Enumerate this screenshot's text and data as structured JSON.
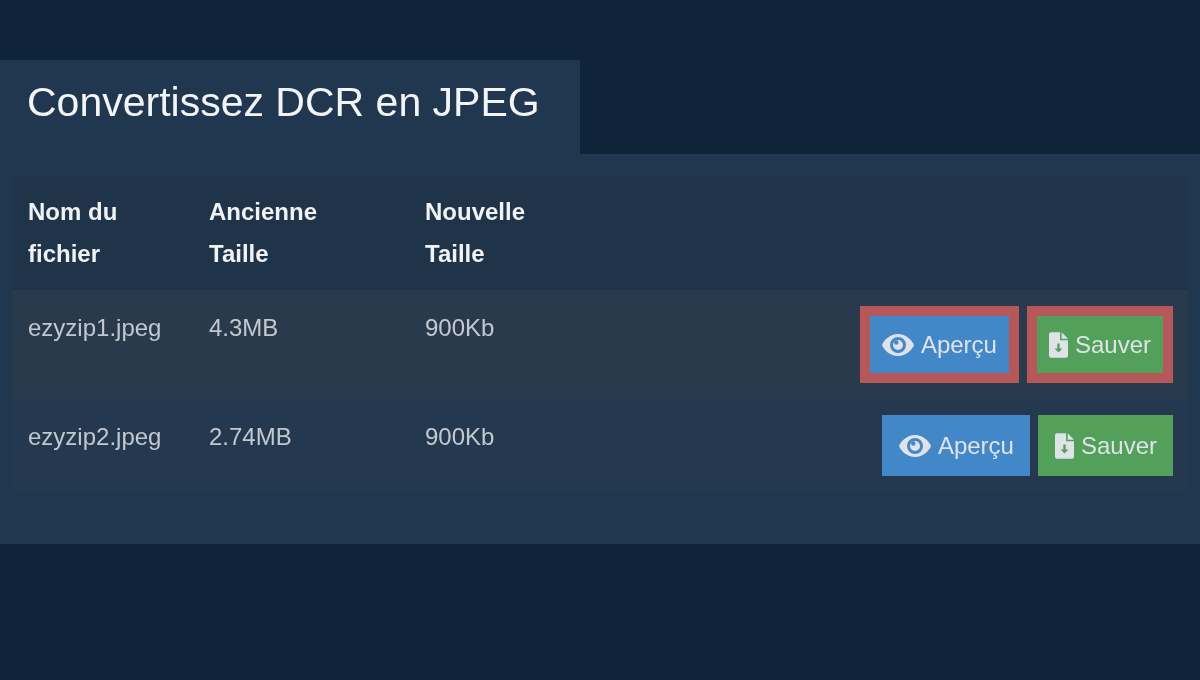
{
  "title": "Convertissez DCR en JPEG",
  "table": {
    "columns": [
      "Nom du fichier",
      "Ancienne Taille",
      "Nouvelle Taille"
    ],
    "rows": [
      {
        "file_name": "ezyzip1.jpeg",
        "old_size": "4.3MB",
        "new_size": "900Kb",
        "actions": [
          {
            "kind": "preview",
            "label": "Aperçu",
            "highlighted": true
          },
          {
            "kind": "save",
            "label": "Sauver",
            "highlighted": true
          }
        ]
      },
      {
        "file_name": "ezyzip2.jpeg",
        "old_size": "2.74MB",
        "new_size": "900Kb",
        "actions": [
          {
            "kind": "preview",
            "label": "Aperçu",
            "highlighted": false
          },
          {
            "kind": "save",
            "label": "Sauver",
            "highlighted": false
          }
        ]
      }
    ]
  }
}
